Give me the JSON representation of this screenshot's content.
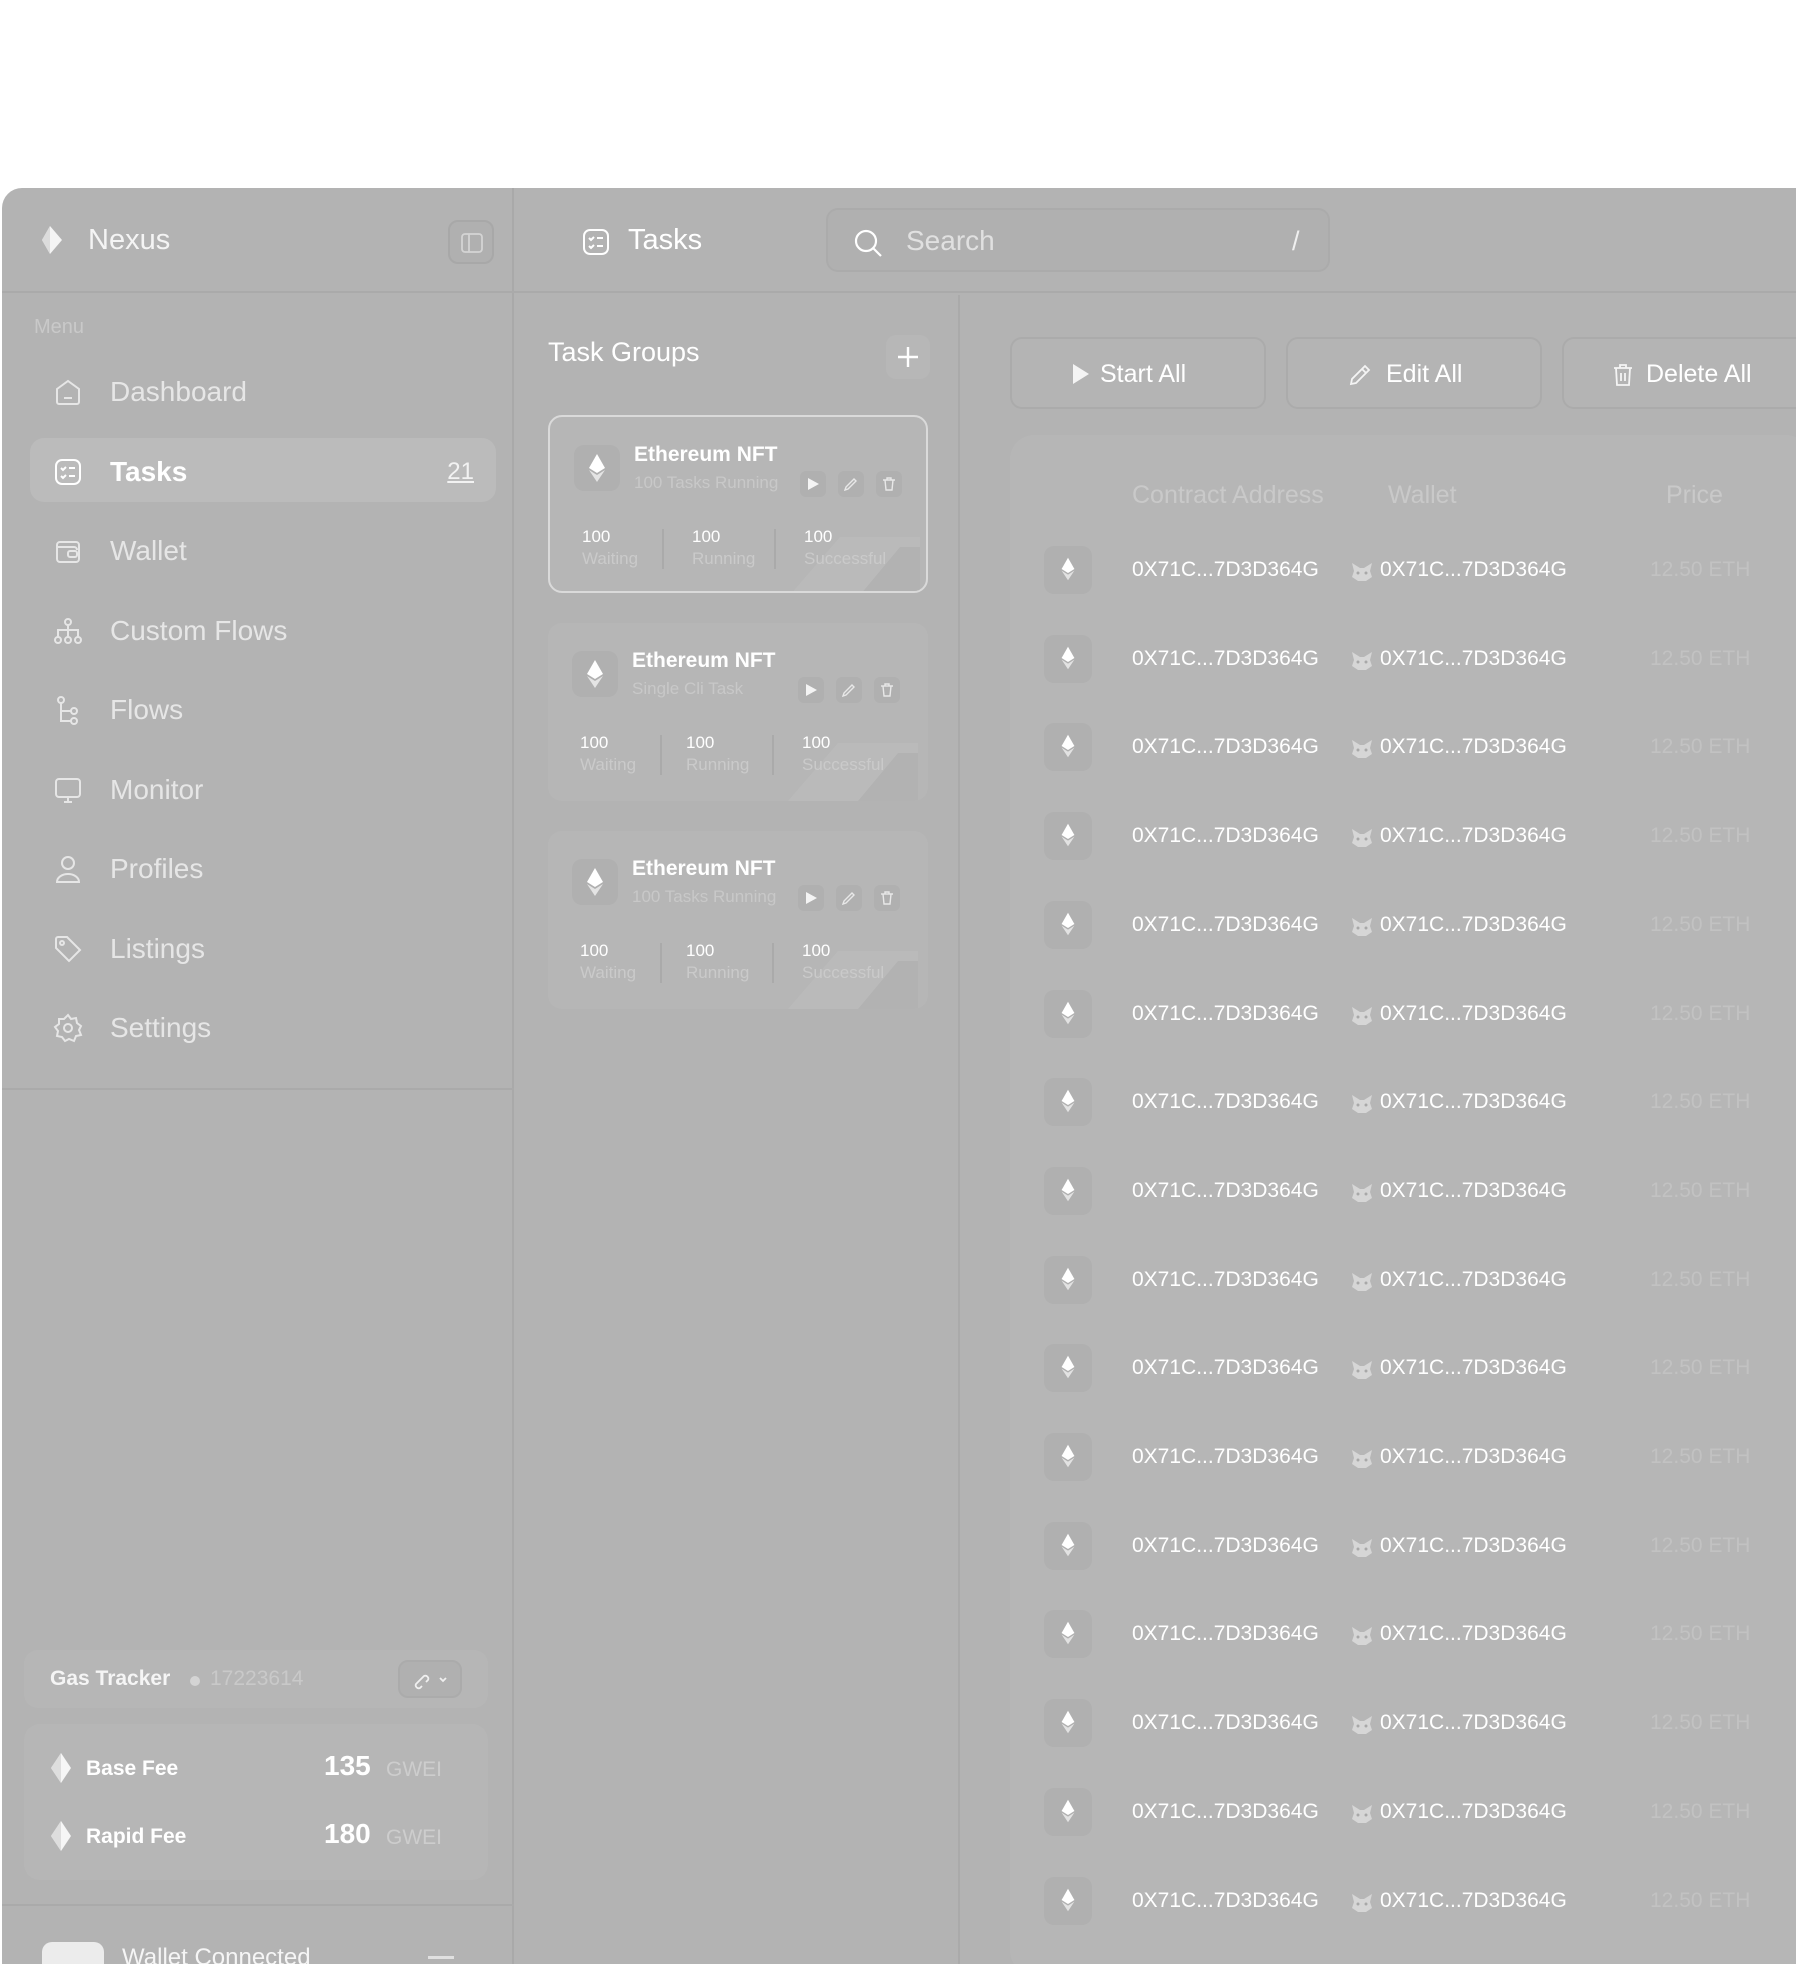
{
  "app": {
    "name": "Nexus"
  },
  "header": {
    "title": "Tasks",
    "search_placeholder": "Search",
    "search_shortcut": "/"
  },
  "sidebar": {
    "menu_label": "Menu",
    "items": [
      {
        "label": "Dashboard",
        "icon": "home-icon"
      },
      {
        "label": "Tasks",
        "icon": "tasks-icon",
        "badge": "21",
        "active": true
      },
      {
        "label": "Wallet",
        "icon": "wallet-icon"
      },
      {
        "label": "Custom Flows",
        "icon": "hierarchy-icon"
      },
      {
        "label": "Flows",
        "icon": "flow-icon"
      },
      {
        "label": "Monitor",
        "icon": "monitor-icon"
      },
      {
        "label": "Profiles",
        "icon": "user-icon"
      },
      {
        "label": "Listings",
        "icon": "tag-icon"
      },
      {
        "label": "Settings",
        "icon": "gear-icon"
      }
    ]
  },
  "gas": {
    "title": "Gas Tracker",
    "block": "17223614",
    "base": {
      "label": "Base Fee",
      "value": "135",
      "unit": "GWEI"
    },
    "rapid": {
      "label": "Rapid Fee",
      "value": "180",
      "unit": "GWEI"
    }
  },
  "wallet_status": {
    "text": "Wallet Connected"
  },
  "task_groups": {
    "title": "Task Groups",
    "cards": [
      {
        "name": "Ethereum NFT",
        "subtitle": "100 Tasks Running",
        "waiting": "100",
        "waiting_label": "Waiting",
        "running": "100",
        "running_label": "Running",
        "successful": "100",
        "successful_label": "Successful"
      },
      {
        "name": "Ethereum NFT",
        "subtitle": "Single Cli Task",
        "waiting": "100",
        "waiting_label": "Waiting",
        "running": "100",
        "running_label": "Running",
        "successful": "100",
        "successful_label": "Successful"
      },
      {
        "name": "Ethereum NFT",
        "subtitle": "100 Tasks Running",
        "waiting": "100",
        "waiting_label": "Waiting",
        "running": "100",
        "running_label": "Running",
        "successful": "100",
        "successful_label": "Successful"
      }
    ]
  },
  "toolbar": {
    "start_all": "Start All",
    "edit_all": "Edit All",
    "delete_all": "Delete All"
  },
  "table": {
    "columns": {
      "contract": "Contract Address",
      "wallet": "Wallet",
      "price": "Price"
    },
    "rows": [
      {
        "contract": "0X71C...7D3D364G",
        "wallet": "0X71C...7D3D364G",
        "price": "12.50 ETH"
      },
      {
        "contract": "0X71C...7D3D364G",
        "wallet": "0X71C...7D3D364G",
        "price": "12.50 ETH"
      },
      {
        "contract": "0X71C...7D3D364G",
        "wallet": "0X71C...7D3D364G",
        "price": "12.50 ETH"
      },
      {
        "contract": "0X71C...7D3D364G",
        "wallet": "0X71C...7D3D364G",
        "price": "12.50 ETH"
      },
      {
        "contract": "0X71C...7D3D364G",
        "wallet": "0X71C...7D3D364G",
        "price": "12.50 ETH"
      },
      {
        "contract": "0X71C...7D3D364G",
        "wallet": "0X71C...7D3D364G",
        "price": "12.50 ETH"
      },
      {
        "contract": "0X71C...7D3D364G",
        "wallet": "0X71C...7D3D364G",
        "price": "12.50 ETH"
      },
      {
        "contract": "0X71C...7D3D364G",
        "wallet": "0X71C...7D3D364G",
        "price": "12.50 ETH"
      },
      {
        "contract": "0X71C...7D3D364G",
        "wallet": "0X71C...7D3D364G",
        "price": "12.50 ETH"
      },
      {
        "contract": "0X71C...7D3D364G",
        "wallet": "0X71C...7D3D364G",
        "price": "12.50 ETH"
      },
      {
        "contract": "0X71C...7D3D364G",
        "wallet": "0X71C...7D3D364G",
        "price": "12.50 ETH"
      },
      {
        "contract": "0X71C...7D3D364G",
        "wallet": "0X71C...7D3D364G",
        "price": "12.50 ETH"
      },
      {
        "contract": "0X71C...7D3D364G",
        "wallet": "0X71C...7D3D364G",
        "price": "12.50 ETH"
      },
      {
        "contract": "0X71C...7D3D364G",
        "wallet": "0X71C...7D3D364G",
        "price": "12.50 ETH"
      },
      {
        "contract": "0X71C...7D3D364G",
        "wallet": "0X71C...7D3D364G",
        "price": "12.50 ETH"
      },
      {
        "contract": "0X71C...7D3D364G",
        "wallet": "0X71C...7D3D364G",
        "price": "12.50 ETH"
      }
    ]
  },
  "colors": {
    "surface": "#b3b3b3",
    "card": "#b6b6b6",
    "text": "#ffffff",
    "muted": "#c9c9c9"
  }
}
